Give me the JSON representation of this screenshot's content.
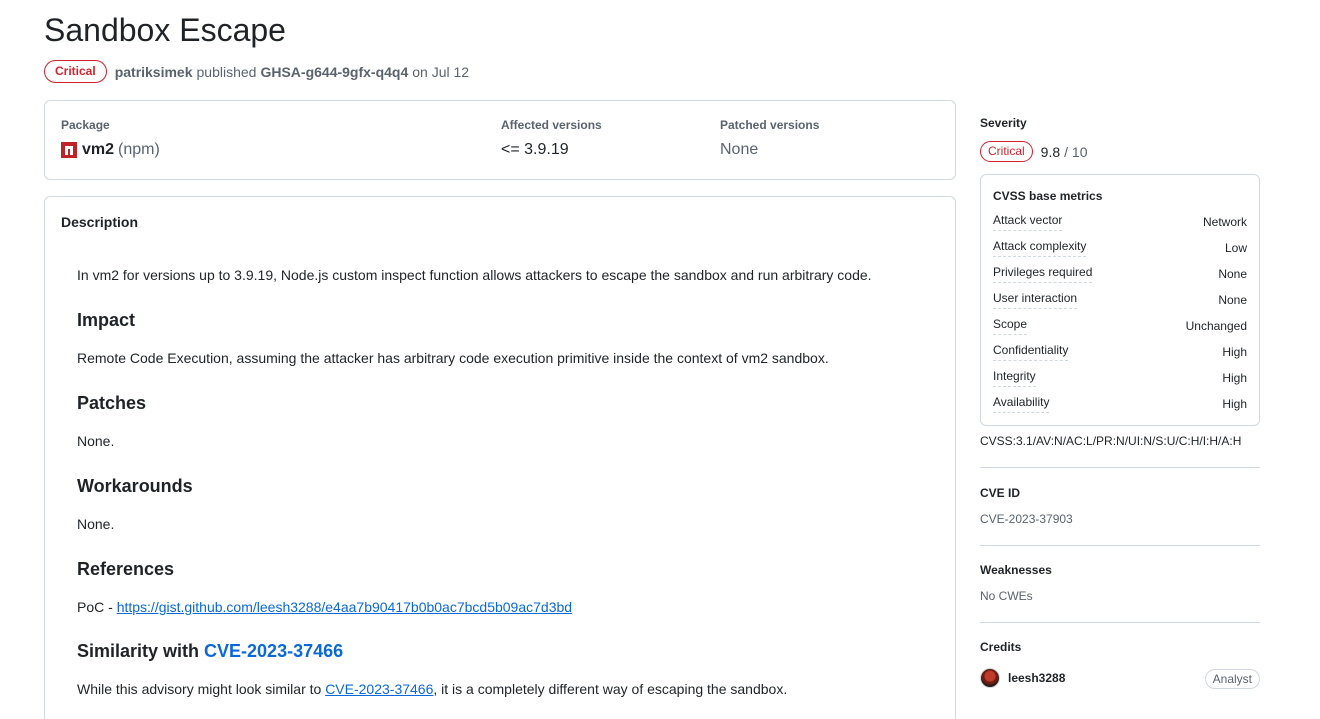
{
  "advisory": {
    "title": "Sandbox Escape",
    "severity_badge": "Critical",
    "author": "patriksimek",
    "published_word": "published",
    "ghsa_id": "GHSA-g644-9gfx-q4q4",
    "date_text": "on Jul 12"
  },
  "package": {
    "label": "Package",
    "name": "vm2",
    "ecosystem": "(npm)",
    "affected_label": "Affected versions",
    "affected_value": "<= 3.9.19",
    "patched_label": "Patched versions",
    "patched_value": "None",
    "icon": "npm-icon"
  },
  "description": {
    "heading": "Description",
    "intro": "In vm2 for versions up to 3.9.19, Node.js custom inspect function allows attackers to escape the sandbox and run arbitrary code.",
    "impact_heading": "Impact",
    "impact_text": "Remote Code Execution, assuming the attacker has arbitrary code execution primitive inside the context of vm2 sandbox.",
    "patches_heading": "Patches",
    "patches_text": "None.",
    "workarounds_heading": "Workarounds",
    "workarounds_text": "None.",
    "references_heading": "References",
    "references_prefix": "PoC - ",
    "references_link": "https://gist.github.com/leesh3288/e4aa7b90417b0b0ac7bcd5b09ac7d3bd",
    "similarity_heading_prefix": "Similarity with ",
    "similarity_heading_link": "CVE-2023-37466",
    "similarity_text_prefix": "While this advisory might look similar to ",
    "similarity_text_link": "CVE-2023-37466",
    "similarity_text_suffix": ", it is a completely different way of escaping the sandbox."
  },
  "sidebar": {
    "severity_label": "Severity",
    "severity_badge": "Critical",
    "score": "9.8",
    "score_of": "/ 10",
    "cvss_title": "CVSS base metrics",
    "metrics": [
      {
        "name": "Attack vector",
        "value": "Network"
      },
      {
        "name": "Attack complexity",
        "value": "Low"
      },
      {
        "name": "Privileges required",
        "value": "None"
      },
      {
        "name": "User interaction",
        "value": "None"
      },
      {
        "name": "Scope",
        "value": "Unchanged"
      },
      {
        "name": "Confidentiality",
        "value": "High"
      },
      {
        "name": "Integrity",
        "value": "High"
      },
      {
        "name": "Availability",
        "value": "High"
      }
    ],
    "vector": "CVSS:3.1/AV:N/AC:L/PR:N/UI:N/S:U/C:H/I:H/A:H",
    "cve_label": "CVE ID",
    "cve_value": "CVE-2023-37903",
    "weaknesses_label": "Weaknesses",
    "weaknesses_value": "No CWEs",
    "credits_label": "Credits",
    "credit_name": "leesh3288",
    "credit_role": "Analyst"
  },
  "colors": {
    "critical": "#cf222e",
    "link": "#0969da",
    "npm": "#c12127"
  }
}
